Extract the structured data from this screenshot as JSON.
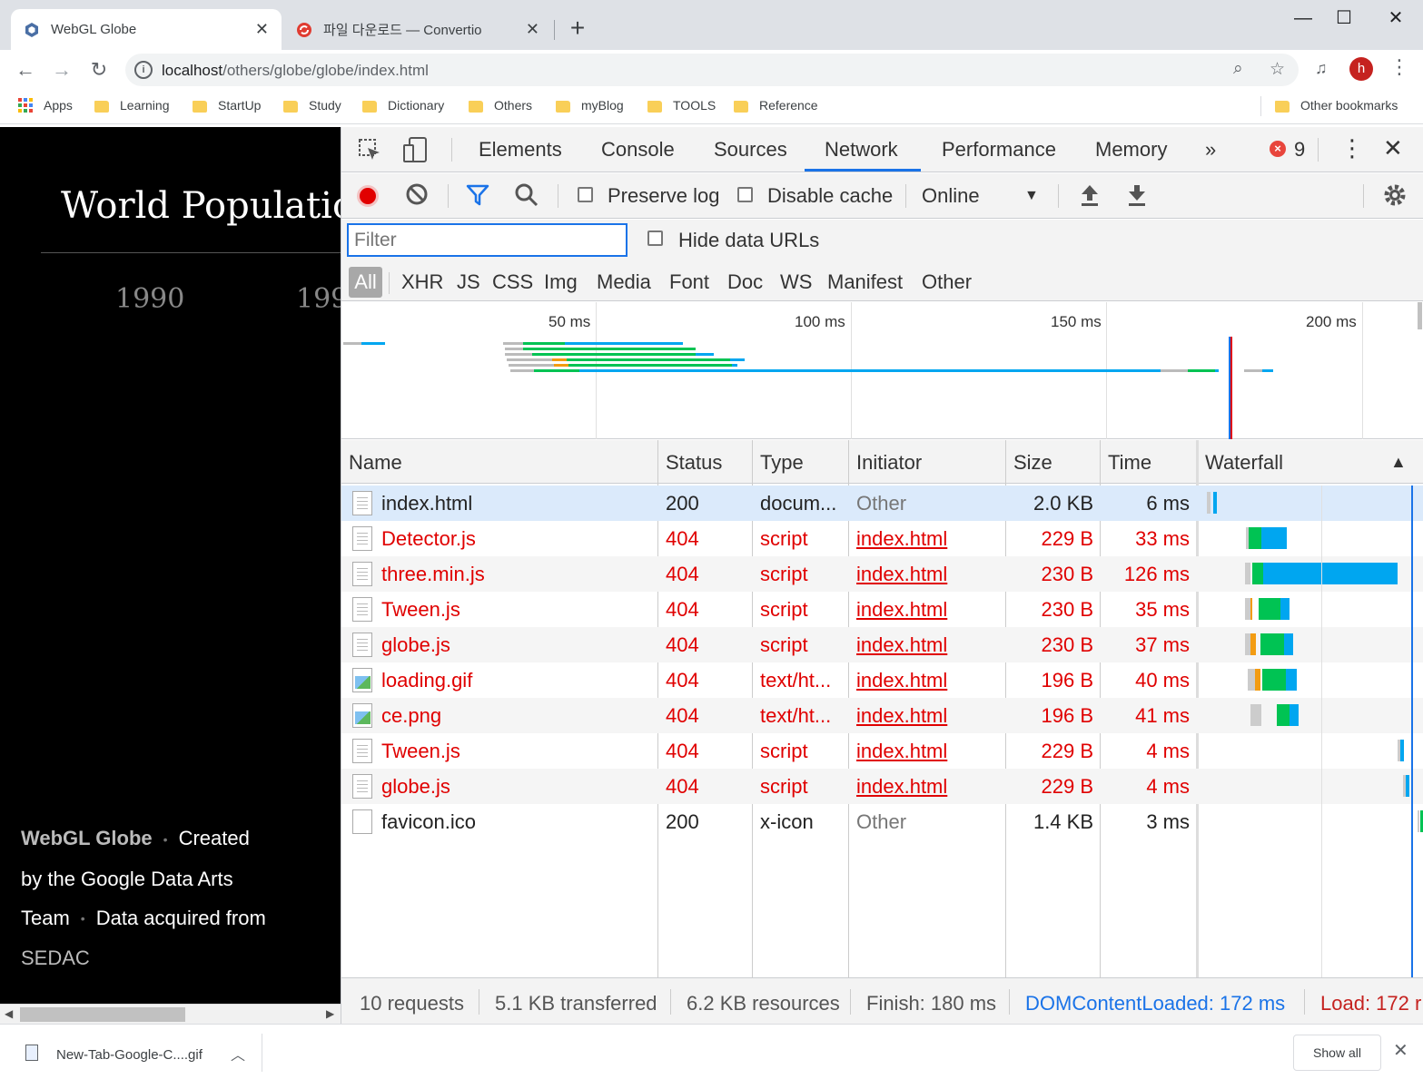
{
  "browser": {
    "tabs": [
      {
        "title": "WebGL Globe",
        "close": "✕"
      },
      {
        "title": "파일 다운로드 — Convertio",
        "close": "✕"
      }
    ],
    "new_tab": "+",
    "window_controls": {
      "minimize": "—",
      "maximize": "☐",
      "close": "✕"
    },
    "url_host": "localhost",
    "url_path": "/others/globe/globe/index.html",
    "avatar_letter": "h",
    "bookmarks": [
      "Apps",
      "Learning",
      "StartUp",
      "Study",
      "Dictionary",
      "Others",
      "myBlog",
      "TOOLS",
      "Reference"
    ],
    "other_bookmarks": "Other bookmarks"
  },
  "page": {
    "title": "World Populatio",
    "years": [
      "1990",
      "199"
    ],
    "credits": {
      "app": "WebGL Globe",
      "created": "Created",
      "by": "by the Google Data Arts",
      "team": "Team",
      "acquired": "Data acquired from",
      "source": "SEDAC",
      "dot": "•"
    }
  },
  "devtools": {
    "tabs": [
      "Elements",
      "Console",
      "Sources",
      "Network",
      "Performance",
      "Memory"
    ],
    "active_tab": "Network",
    "more": "»",
    "error_count": "9",
    "toolbar": {
      "preserve_log": "Preserve log",
      "disable_cache": "Disable cache",
      "throttle": "Online"
    },
    "filter_placeholder": "Filter",
    "hide_data_urls": "Hide data URLs",
    "types": [
      "All",
      "XHR",
      "JS",
      "CSS",
      "Img",
      "Media",
      "Font",
      "Doc",
      "WS",
      "Manifest",
      "Other"
    ],
    "overview_labels": [
      "50 ms",
      "100 ms",
      "150 ms",
      "200 ms"
    ],
    "columns": [
      "Name",
      "Status",
      "Type",
      "Initiator",
      "Size",
      "Time",
      "Waterfall"
    ],
    "requests": [
      {
        "name": "index.html",
        "status": "200",
        "type": "docum...",
        "initiator": "Other",
        "size": "2.0 KB",
        "time": "6 ms"
      },
      {
        "name": "Detector.js",
        "status": "404",
        "type": "script",
        "initiator": "index.html",
        "size": "229 B",
        "time": "33 ms"
      },
      {
        "name": "three.min.js",
        "status": "404",
        "type": "script",
        "initiator": "index.html",
        "size": "230 B",
        "time": "126 ms"
      },
      {
        "name": "Tween.js",
        "status": "404",
        "type": "script",
        "initiator": "index.html",
        "size": "230 B",
        "time": "35 ms"
      },
      {
        "name": "globe.js",
        "status": "404",
        "type": "script",
        "initiator": "index.html",
        "size": "230 B",
        "time": "37 ms"
      },
      {
        "name": "loading.gif",
        "status": "404",
        "type": "text/ht...",
        "initiator": "index.html",
        "size": "196 B",
        "time": "40 ms"
      },
      {
        "name": "ce.png",
        "status": "404",
        "type": "text/ht...",
        "initiator": "index.html",
        "size": "196 B",
        "time": "41 ms"
      },
      {
        "name": "Tween.js",
        "status": "404",
        "type": "script",
        "initiator": "index.html",
        "size": "229 B",
        "time": "4 ms"
      },
      {
        "name": "globe.js",
        "status": "404",
        "type": "script",
        "initiator": "index.html",
        "size": "229 B",
        "time": "4 ms"
      },
      {
        "name": "favicon.ico",
        "status": "200",
        "type": "x-icon",
        "initiator": "Other",
        "size": "1.4 KB",
        "time": "3 ms"
      }
    ],
    "summary": {
      "requests": "10 requests",
      "transferred": "5.1 KB transferred",
      "resources": "6.2 KB resources",
      "finish": "Finish: 180 ms",
      "dcl": "DOMContentLoaded: 172 ms",
      "load": "Load: 172 r"
    },
    "colors": {
      "accent": "#1a73e8",
      "error": "#e00000",
      "waiting": "#00c353",
      "download": "#00a6f0"
    }
  },
  "download_shelf": {
    "file": "New-Tab-Google-C....gif",
    "show_all": "Show all",
    "close": "✕"
  }
}
